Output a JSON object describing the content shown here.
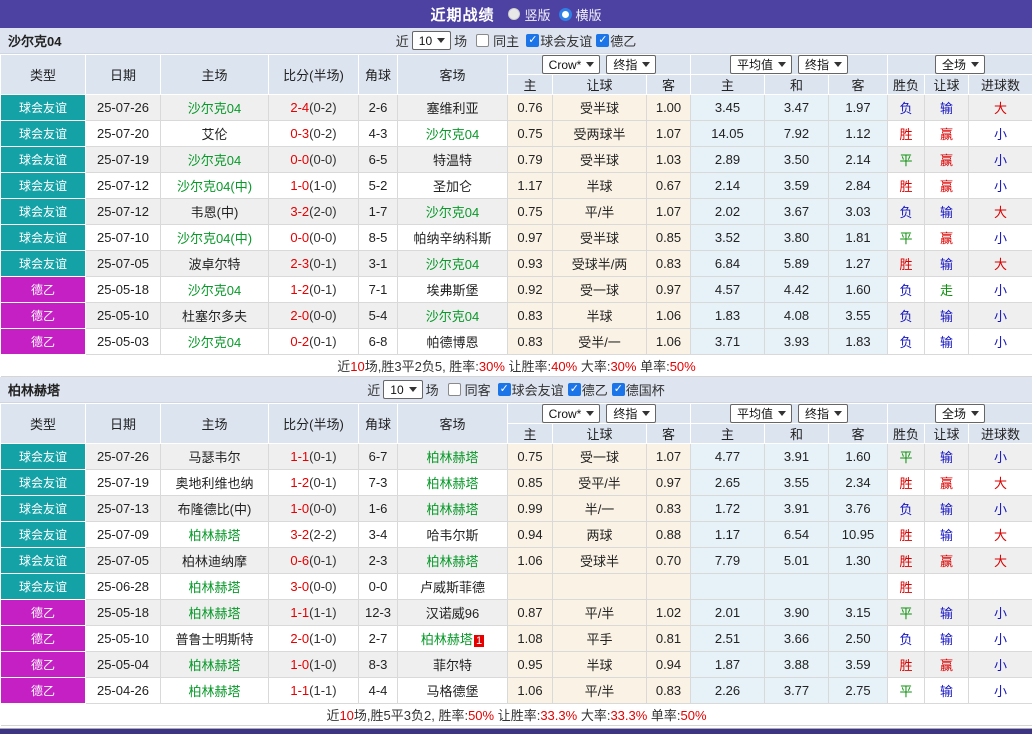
{
  "title_bar": {
    "title": "近期战绩",
    "options": [
      {
        "label": "竖版",
        "selected": false
      },
      {
        "label": "横版",
        "selected": true
      }
    ]
  },
  "colors": {
    "topbar_purple": "#4D41A1",
    "bottombar_purple": "#3E3484",
    "friendly_teal": "#14A2A7",
    "league2_magenta": "#C420C4",
    "focus_team_green": "#089929",
    "score_red": "#E60000",
    "result_red": "#D90000",
    "result_blue": "#1515C0",
    "result_green": "#0B8F0B",
    "handicap_col_bg": "#FAF3E5",
    "average_col_bg": "#E6F1F8",
    "header_bg": "#DCE4F0"
  },
  "sections": [
    {
      "team": "沙尔克04",
      "filter": {
        "near": "近",
        "num": "10",
        "unit": "场",
        "same": {
          "label": "同主",
          "checked": false
        },
        "leagues": [
          {
            "label": "球会友谊",
            "checked": true
          },
          {
            "label": "德乙",
            "checked": true
          }
        ]
      },
      "header": {
        "cols": [
          "类型",
          "日期",
          "主场",
          "比分(半场)",
          "角球",
          "客场"
        ],
        "sel_crown": "Crow*",
        "sel_crown_stage": "终指",
        "sel_avg": "平均值",
        "sel_avg_stage": "终指",
        "sel_full": "全场",
        "sub": [
          "主",
          "让球",
          "客",
          "主",
          "和",
          "客",
          "胜负",
          "让球",
          "进球数"
        ]
      },
      "rows": [
        {
          "tp": "球会友谊",
          "tc": "teal",
          "d": "25-07-26",
          "h": "沙尔克04",
          "hg": true,
          "s": "2-4",
          "sh": "(0-2)",
          "ck": "2-6",
          "a": "塞维利亚",
          "ag": false,
          "ab": "",
          "o1": "0.76",
          "hd": "受半球",
          "o2": "1.00",
          "m1": "3.45",
          "m2": "3.47",
          "m3": "1.97",
          "r1": "负",
          "c1": "blue",
          "r2": "输",
          "c2": "blue",
          "r3": "大",
          "c3": "red"
        },
        {
          "tp": "球会友谊",
          "tc": "teal",
          "d": "25-07-20",
          "h": "艾伦",
          "hg": false,
          "s": "0-3",
          "sh": "(0-2)",
          "ck": "4-3",
          "a": "沙尔克04",
          "ag": true,
          "ab": "",
          "o1": "0.75",
          "hd": "受两球半",
          "o2": "1.07",
          "m1": "14.05",
          "m2": "7.92",
          "m3": "1.12",
          "r1": "胜",
          "c1": "red",
          "r2": "赢",
          "c2": "red",
          "r3": "小",
          "c3": "blue"
        },
        {
          "tp": "球会友谊",
          "tc": "teal",
          "d": "25-07-19",
          "h": "沙尔克04",
          "hg": true,
          "s": "0-0",
          "sh": "(0-0)",
          "ck": "6-5",
          "a": "特温特",
          "ag": false,
          "ab": "",
          "o1": "0.79",
          "hd": "受半球",
          "o2": "1.03",
          "m1": "2.89",
          "m2": "3.50",
          "m3": "2.14",
          "r1": "平",
          "c1": "green",
          "r2": "赢",
          "c2": "red",
          "r3": "小",
          "c3": "blue"
        },
        {
          "tp": "球会友谊",
          "tc": "teal",
          "d": "25-07-12",
          "h": "沙尔克04(中)",
          "hg": true,
          "s": "1-0",
          "sh": "(1-0)",
          "ck": "5-2",
          "a": "圣加仑",
          "ag": false,
          "ab": "",
          "o1": "1.17",
          "hd": "半球",
          "o2": "0.67",
          "m1": "2.14",
          "m2": "3.59",
          "m3": "2.84",
          "r1": "胜",
          "c1": "red",
          "r2": "赢",
          "c2": "red",
          "r3": "小",
          "c3": "blue"
        },
        {
          "tp": "球会友谊",
          "tc": "teal",
          "d": "25-07-12",
          "h": "韦恩(中)",
          "hg": false,
          "s": "3-2",
          "sh": "(2-0)",
          "ck": "1-7",
          "a": "沙尔克04",
          "ag": true,
          "ab": "",
          "o1": "0.75",
          "hd": "平/半",
          "o2": "1.07",
          "m1": "2.02",
          "m2": "3.67",
          "m3": "3.03",
          "r1": "负",
          "c1": "blue",
          "r2": "输",
          "c2": "blue",
          "r3": "大",
          "c3": "red"
        },
        {
          "tp": "球会友谊",
          "tc": "teal",
          "d": "25-07-10",
          "h": "沙尔克04(中)",
          "hg": true,
          "s": "0-0",
          "sh": "(0-0)",
          "ck": "8-5",
          "a": "帕纳辛纳科斯",
          "ag": false,
          "ab": "",
          "o1": "0.97",
          "hd": "受半球",
          "o2": "0.85",
          "m1": "3.52",
          "m2": "3.80",
          "m3": "1.81",
          "r1": "平",
          "c1": "green",
          "r2": "赢",
          "c2": "red",
          "r3": "小",
          "c3": "blue"
        },
        {
          "tp": "球会友谊",
          "tc": "teal",
          "d": "25-07-05",
          "h": "波卓尔特",
          "hg": false,
          "s": "2-3",
          "sh": "(0-1)",
          "ck": "3-1",
          "a": "沙尔克04",
          "ag": true,
          "ab": "",
          "o1": "0.93",
          "hd": "受球半/两",
          "o2": "0.83",
          "m1": "6.84",
          "m2": "5.89",
          "m3": "1.27",
          "r1": "胜",
          "c1": "red",
          "r2": "输",
          "c2": "blue",
          "r3": "大",
          "c3": "red"
        },
        {
          "tp": "德乙",
          "tc": "magenta",
          "d": "25-05-18",
          "h": "沙尔克04",
          "hg": true,
          "s": "1-2",
          "sh": "(0-1)",
          "ck": "7-1",
          "a": "埃弗斯堡",
          "ag": false,
          "ab": "",
          "o1": "0.92",
          "hd": "受一球",
          "o2": "0.97",
          "m1": "4.57",
          "m2": "4.42",
          "m3": "1.60",
          "r1": "负",
          "c1": "blue",
          "r2": "走",
          "c2": "green",
          "r3": "小",
          "c3": "blue"
        },
        {
          "tp": "德乙",
          "tc": "magenta",
          "d": "25-05-10",
          "h": "杜塞尔多夫",
          "hg": false,
          "s": "2-0",
          "sh": "(0-0)",
          "ck": "5-4",
          "a": "沙尔克04",
          "ag": true,
          "ab": "",
          "o1": "0.83",
          "hd": "半球",
          "o2": "1.06",
          "m1": "1.83",
          "m2": "4.08",
          "m3": "3.55",
          "r1": "负",
          "c1": "blue",
          "r2": "输",
          "c2": "blue",
          "r3": "小",
          "c3": "blue"
        },
        {
          "tp": "德乙",
          "tc": "magenta",
          "d": "25-05-03",
          "h": "沙尔克04",
          "hg": true,
          "s": "0-2",
          "sh": "(0-1)",
          "ck": "6-8",
          "a": "帕德博恩",
          "ag": false,
          "ab": "",
          "o1": "0.83",
          "hd": "受半/一",
          "o2": "1.06",
          "m1": "3.71",
          "m2": "3.93",
          "m3": "1.83",
          "r1": "负",
          "c1": "blue",
          "r2": "输",
          "c2": "blue",
          "r3": "小",
          "c3": "blue"
        }
      ],
      "summary": [
        {
          "t": "近",
          "hl": false
        },
        {
          "t": "10",
          "hl": true
        },
        {
          "t": "场,胜3平2负5, 胜率:",
          "hl": false
        },
        {
          "t": "30%",
          "hl": true
        },
        {
          "t": " 让胜率:",
          "hl": false
        },
        {
          "t": "40%",
          "hl": true
        },
        {
          "t": " 大率:",
          "hl": false
        },
        {
          "t": "30%",
          "hl": true
        },
        {
          "t": " 单率:",
          "hl": false
        },
        {
          "t": "50%",
          "hl": true
        }
      ]
    },
    {
      "team": "柏林赫塔",
      "filter": {
        "near": "近",
        "num": "10",
        "unit": "场",
        "same": {
          "label": "同客",
          "checked": false
        },
        "leagues": [
          {
            "label": "球会友谊",
            "checked": true
          },
          {
            "label": "德乙",
            "checked": true
          },
          {
            "label": "德国杯",
            "checked": true
          }
        ]
      },
      "header": {
        "cols": [
          "类型",
          "日期",
          "主场",
          "比分(半场)",
          "角球",
          "客场"
        ],
        "sel_crown": "Crow*",
        "sel_crown_stage": "终指",
        "sel_avg": "平均值",
        "sel_avg_stage": "终指",
        "sel_full": "全场",
        "sub": [
          "主",
          "让球",
          "客",
          "主",
          "和",
          "客",
          "胜负",
          "让球",
          "进球数"
        ]
      },
      "rows": [
        {
          "tp": "球会友谊",
          "tc": "teal",
          "d": "25-07-26",
          "h": "马瑟韦尔",
          "hg": false,
          "s": "1-1",
          "sh": "(0-1)",
          "ck": "6-7",
          "a": "柏林赫塔",
          "ag": true,
          "ab": "",
          "o1": "0.75",
          "hd": "受一球",
          "o2": "1.07",
          "m1": "4.77",
          "m2": "3.91",
          "m3": "1.60",
          "r1": "平",
          "c1": "green",
          "r2": "输",
          "c2": "blue",
          "r3": "小",
          "c3": "blue"
        },
        {
          "tp": "球会友谊",
          "tc": "teal",
          "d": "25-07-19",
          "h": "奥地利维也纳",
          "hg": false,
          "s": "1-2",
          "sh": "(0-1)",
          "ck": "7-3",
          "a": "柏林赫塔",
          "ag": true,
          "ab": "",
          "o1": "0.85",
          "hd": "受平/半",
          "o2": "0.97",
          "m1": "2.65",
          "m2": "3.55",
          "m3": "2.34",
          "r1": "胜",
          "c1": "red",
          "r2": "赢",
          "c2": "red",
          "r3": "大",
          "c3": "red"
        },
        {
          "tp": "球会友谊",
          "tc": "teal",
          "d": "25-07-13",
          "h": "布隆德比(中)",
          "hg": false,
          "s": "1-0",
          "sh": "(0-0)",
          "ck": "1-6",
          "a": "柏林赫塔",
          "ag": true,
          "ab": "",
          "o1": "0.99",
          "hd": "半/一",
          "o2": "0.83",
          "m1": "1.72",
          "m2": "3.91",
          "m3": "3.76",
          "r1": "负",
          "c1": "blue",
          "r2": "输",
          "c2": "blue",
          "r3": "小",
          "c3": "blue"
        },
        {
          "tp": "球会友谊",
          "tc": "teal",
          "d": "25-07-09",
          "h": "柏林赫塔",
          "hg": true,
          "s": "3-2",
          "sh": "(2-2)",
          "ck": "3-4",
          "a": "哈韦尔斯",
          "ag": false,
          "ab": "",
          "o1": "0.94",
          "hd": "两球",
          "o2": "0.88",
          "m1": "1.17",
          "m2": "6.54",
          "m3": "10.95",
          "r1": "胜",
          "c1": "red",
          "r2": "输",
          "c2": "blue",
          "r3": "大",
          "c3": "red"
        },
        {
          "tp": "球会友谊",
          "tc": "teal",
          "d": "25-07-05",
          "h": "柏林迪纳摩",
          "hg": false,
          "s": "0-6",
          "sh": "(0-1)",
          "ck": "2-3",
          "a": "柏林赫塔",
          "ag": true,
          "ab": "",
          "o1": "1.06",
          "hd": "受球半",
          "o2": "0.70",
          "m1": "7.79",
          "m2": "5.01",
          "m3": "1.30",
          "r1": "胜",
          "c1": "red",
          "r2": "赢",
          "c2": "red",
          "r3": "大",
          "c3": "red"
        },
        {
          "tp": "球会友谊",
          "tc": "teal",
          "d": "25-06-28",
          "h": "柏林赫塔",
          "hg": true,
          "s": "3-0",
          "sh": "(0-0)",
          "ck": "0-0",
          "a": "卢威斯菲德",
          "ag": false,
          "ab": "",
          "o1": "",
          "hd": "",
          "o2": "",
          "m1": "",
          "m2": "",
          "m3": "",
          "r1": "胜",
          "c1": "red",
          "r2": "",
          "c2": "",
          "r3": "",
          "c3": ""
        },
        {
          "tp": "德乙",
          "tc": "magenta",
          "d": "25-05-18",
          "h": "柏林赫塔",
          "hg": true,
          "s": "1-1",
          "sh": "(1-1)",
          "ck": "12-3",
          "a": "汉诺威96",
          "ag": false,
          "ab": "",
          "o1": "0.87",
          "hd": "平/半",
          "o2": "1.02",
          "m1": "2.01",
          "m2": "3.90",
          "m3": "3.15",
          "r1": "平",
          "c1": "green",
          "r2": "输",
          "c2": "blue",
          "r3": "小",
          "c3": "blue"
        },
        {
          "tp": "德乙",
          "tc": "magenta",
          "d": "25-05-10",
          "h": "普鲁士明斯特",
          "hg": false,
          "s": "2-0",
          "sh": "(1-0)",
          "ck": "2-7",
          "a": "柏林赫塔",
          "ag": true,
          "ab": "1",
          "o1": "1.08",
          "hd": "平手",
          "o2": "0.81",
          "m1": "2.51",
          "m2": "3.66",
          "m3": "2.50",
          "r1": "负",
          "c1": "blue",
          "r2": "输",
          "c2": "blue",
          "r3": "小",
          "c3": "blue"
        },
        {
          "tp": "德乙",
          "tc": "magenta",
          "d": "25-05-04",
          "h": "柏林赫塔",
          "hg": true,
          "s": "1-0",
          "sh": "(1-0)",
          "ck": "8-3",
          "a": "菲尔特",
          "ag": false,
          "ab": "",
          "o1": "0.95",
          "hd": "半球",
          "o2": "0.94",
          "m1": "1.87",
          "m2": "3.88",
          "m3": "3.59",
          "r1": "胜",
          "c1": "red",
          "r2": "赢",
          "c2": "red",
          "r3": "小",
          "c3": "blue"
        },
        {
          "tp": "德乙",
          "tc": "magenta",
          "d": "25-04-26",
          "h": "柏林赫塔",
          "hg": true,
          "s": "1-1",
          "sh": "(1-1)",
          "ck": "4-4",
          "a": "马格德堡",
          "ag": false,
          "ab": "",
          "o1": "1.06",
          "hd": "平/半",
          "o2": "0.83",
          "m1": "2.26",
          "m2": "3.77",
          "m3": "2.75",
          "r1": "平",
          "c1": "green",
          "r2": "输",
          "c2": "blue",
          "r3": "小",
          "c3": "blue"
        }
      ],
      "summary": [
        {
          "t": "近",
          "hl": false
        },
        {
          "t": "10",
          "hl": true
        },
        {
          "t": "场,胜5平3负2, 胜率:",
          "hl": false
        },
        {
          "t": "50%",
          "hl": true
        },
        {
          "t": " 让胜率:",
          "hl": false
        },
        {
          "t": "33.3%",
          "hl": true
        },
        {
          "t": " 大率:",
          "hl": false
        },
        {
          "t": "33.3%",
          "hl": true
        },
        {
          "t": " 单率:",
          "hl": false
        },
        {
          "t": "50%",
          "hl": true
        }
      ]
    }
  ]
}
